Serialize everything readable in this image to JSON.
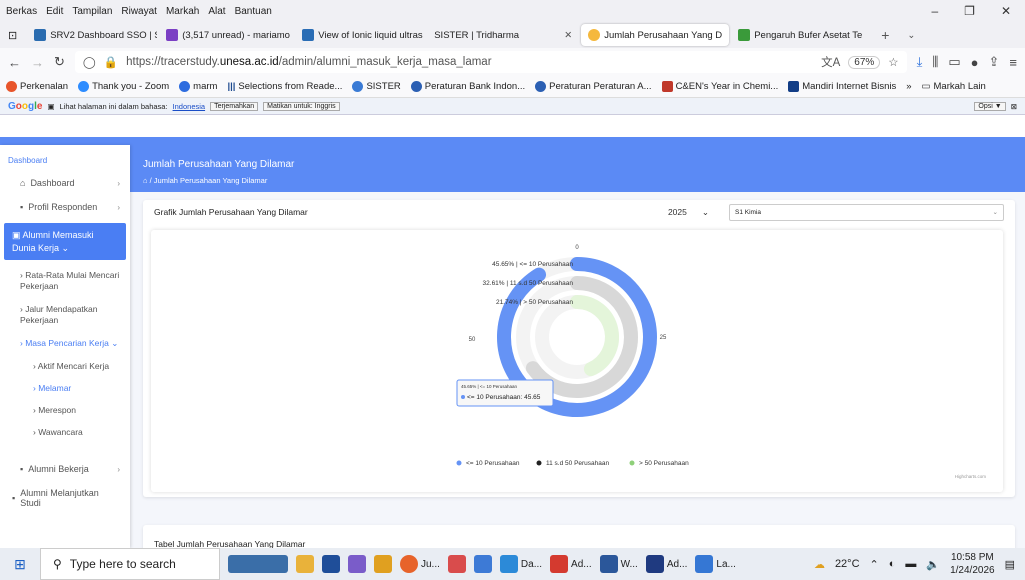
{
  "menu": [
    "Berkas",
    "Edit",
    "Tampilan",
    "Riwayat",
    "Markah",
    "Alat",
    "Bantuan"
  ],
  "tabs": [
    {
      "label": "SRV2 Dashboard SSO | Si",
      "color": "#2b6cb0"
    },
    {
      "label": "(3,517 unread) - mariamo",
      "color": "#7b3fc4"
    },
    {
      "label": "View of Ionic liquid ultras",
      "color": "#2a6db5"
    },
    {
      "label": "SISTER | Tridharma",
      "color": "#ffffff"
    },
    {
      "label": "Jumlah Perusahaan Yang D",
      "color": "#f5b83d",
      "active": true
    },
    {
      "label": "Pengaruh Bufer Asetat Te",
      "color": "#3a9a3a"
    }
  ],
  "url": {
    "prefix": "https://tracerstudy.",
    "domain": "unesa.ac.id",
    "path": "/admin/alumni_masuk_kerja_masa_lamar",
    "zoom": "67%"
  },
  "bookmarks": [
    {
      "label": "Perkenalan",
      "color": "#e8552b"
    },
    {
      "label": "Thank you - Zoom",
      "color": "#2d8cff"
    },
    {
      "label": "marm",
      "color": "#2d6cdf"
    },
    {
      "label": "Selections from Reade...",
      "color": "#1d4a8f"
    },
    {
      "label": "SISTER",
      "color": "#3a7bd5"
    },
    {
      "label": "Peraturan Bank Indon...",
      "color": "#2b5fb3"
    },
    {
      "label": "Peraturan Peraturan A...",
      "color": "#2b5fb3"
    },
    {
      "label": "C&EN's Year in Chemi...",
      "color": "#c0392b"
    },
    {
      "label": "Mandiri Internet Bisnis",
      "color": "#123d86"
    },
    {
      "label": "Markah Lain",
      "color": "#666666"
    }
  ],
  "translate": {
    "text": "Lihat halaman ini dalam bahasa:",
    "lang": "Indonesia",
    "btn1": "Terjemahkan",
    "btn2": "Matikan untuk: Inggris",
    "opsi": "Opsi ▼"
  },
  "sidebar": {
    "section": "Dashboard",
    "dashboard": "Dashboard",
    "profil": "Profil Responden",
    "alumni_kerja": "Alumni Memasuki Dunia Kerja",
    "rata": "Rata-Rata Mulai Mencari Pekerjaan",
    "jalur": "Jalur Mendapatkan Pekerjaan",
    "masa": "Masa Pencarian Kerja",
    "aktif": "Aktif Mencari Kerja",
    "melamar": "Melamar",
    "merespon": "Merespon",
    "wawancara": "Wawancara",
    "bekerja": "Alumni Bekerja",
    "melanjutkan": "Alumni Melanjutkan Studi"
  },
  "page": {
    "title": "Jumlah Perusahaan Yang Dilamar",
    "crumb": "Jumlah Perusahaan Yang Dilamar",
    "card_title": "Grafik Jumlah Perusahaan Yang Dilamar",
    "year": "2025",
    "prodi": "S1 Kimia",
    "table_title": "Tabel Jumlah Perusahaan Yang Dilamar"
  },
  "chart_data": {
    "type": "radial-bar",
    "series": [
      {
        "name": "<= 10 Perusahaan",
        "value": 45.65,
        "label": "45.65% | <= 10 Perusahaan",
        "color": "#6593f5"
      },
      {
        "name": "11 s.d 50 Perusahaan",
        "value": 32.61,
        "label": "32.61% | 11 s.d 50 Perusahaan",
        "color": "#d8d8d8"
      },
      {
        "name": "> 50 Perusahaan",
        "value": 21.74,
        "label": "21.74% | > 50 Perusahaan",
        "color": "#e4f5da"
      }
    ],
    "ticks": [
      "0",
      "25",
      "50"
    ],
    "tooltip": {
      "head": "45.65% | <= 10 Perusahaan",
      "body": "<= 10 Perusahaan: 45.65"
    },
    "credit": "Highcharts.com",
    "legend_placement": "bottom"
  },
  "taskbar": {
    "search": "Type here to search",
    "items": [
      "Ju...",
      "Da...",
      "Ad...",
      "W...",
      "Ad...",
      "La..."
    ],
    "temp": "22°C",
    "time": "10:58 PM",
    "date": "1/24/2026"
  }
}
